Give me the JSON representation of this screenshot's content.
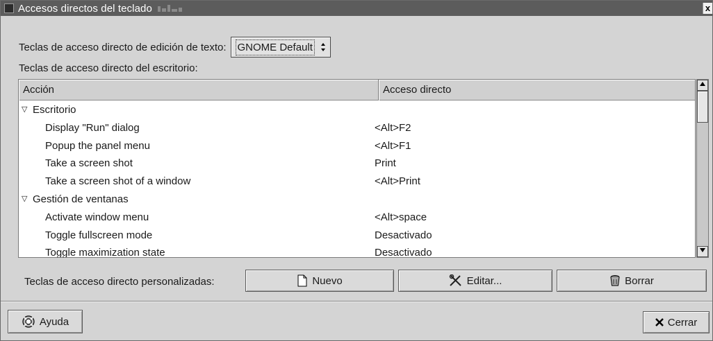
{
  "window": {
    "title": "Accesos directos del teclado",
    "close_glyph": "x"
  },
  "text_edit": {
    "label": "Teclas de acceso directo de edición de texto:",
    "combo_value": "GNOME Default"
  },
  "desktop_label": "Teclas de acceso directo del escritorio:",
  "tree": {
    "columns": [
      "Acción",
      "Acceso directo"
    ],
    "rows": [
      {
        "type": "group",
        "label": "Escritorio",
        "shortcut": ""
      },
      {
        "type": "item",
        "label": "Display \"Run\" dialog",
        "shortcut": "<Alt>F2"
      },
      {
        "type": "item",
        "label": "Popup the panel menu",
        "shortcut": "<Alt>F1"
      },
      {
        "type": "item",
        "label": "Take a screen shot",
        "shortcut": "Print"
      },
      {
        "type": "item",
        "label": "Take a screen shot of a window",
        "shortcut": "<Alt>Print"
      },
      {
        "type": "group",
        "label": "Gestión de ventanas",
        "shortcut": ""
      },
      {
        "type": "item",
        "label": "Activate window menu",
        "shortcut": "<Alt>space"
      },
      {
        "type": "item",
        "label": "Toggle fullscreen mode",
        "shortcut": "Desactivado"
      },
      {
        "type": "item",
        "label": "Toggle maximization state",
        "shortcut": "Desactivado"
      }
    ]
  },
  "custom": {
    "label": "Teclas de acceso directo personalizadas:",
    "new_label": "Nuevo",
    "edit_label": "Editar...",
    "delete_label": "Borrar"
  },
  "footer": {
    "help_label": "Ayuda",
    "close_label": "Cerrar"
  },
  "icons": {
    "new": "document-new-icon",
    "edit": "tools-icon",
    "delete": "trash-icon",
    "help": "lifebuoy-icon",
    "close": "close-x-icon"
  }
}
